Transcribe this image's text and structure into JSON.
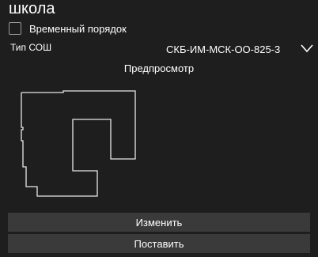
{
  "window": {
    "title": "школа"
  },
  "options": {
    "temporary_order_label": "Временный порядок",
    "temporary_order_checked": false
  },
  "school_type": {
    "label": "Тип СОШ",
    "selected_value": "СКБ-ИМ-МСК-ОО-825-3"
  },
  "preview": {
    "label": "Предпросмотр"
  },
  "buttons": {
    "change_label": "Изменить",
    "place_label": "Поставить"
  },
  "colors": {
    "background": "#1e1e1e",
    "button_bg": "#3a3a3a",
    "outline": "#e8e8e8"
  }
}
